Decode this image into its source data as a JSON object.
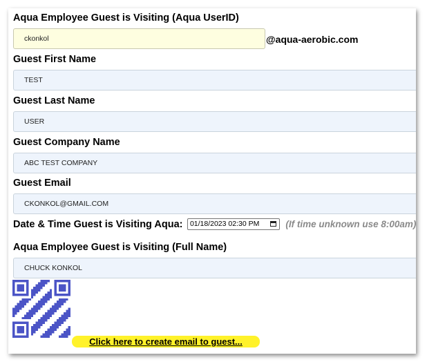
{
  "form": {
    "userid_label": "Aqua Employee Guest is Visiting (Aqua UserID)",
    "userid_value": "ckonkol",
    "userid_domain": "@aqua-aerobic.com",
    "first_name_label": "Guest First Name",
    "first_name_value": "TEST",
    "last_name_label": "Guest Last Name",
    "last_name_value": "USER",
    "company_label": "Guest Company Name",
    "company_value": "ABC TEST COMPANY",
    "email_label": "Guest Email",
    "email_value": "CKONKOL@GMAIL.COM",
    "datetime_label": "Date & Time Guest is Visiting Aqua:",
    "datetime_value": "01/18/2023 02:30 PM",
    "datetime_hint": "(If time unknown use 8:00am)",
    "fullname_label": "Aqua Employee Guest is Visiting (Full Name)",
    "fullname_value": "CHUCK KONKOL"
  },
  "actions": {
    "email_link_label": "Click here to create email to guest..."
  },
  "colors": {
    "highlight": "#fff22a",
    "field_bg": "#eef4fc",
    "userid_bg": "#fefee0",
    "qr_color": "#4b54c6",
    "hint_color": "#8a8a8a"
  },
  "icons": {
    "qr_code": "qr-code-icon",
    "calendar": "calendar-icon"
  }
}
